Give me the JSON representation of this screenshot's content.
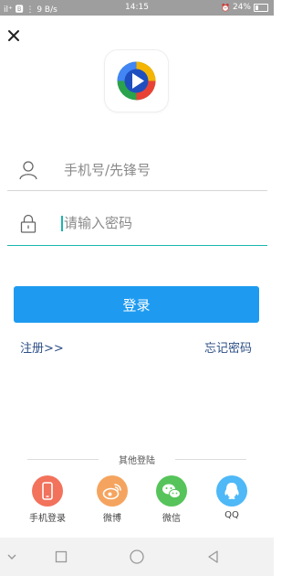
{
  "status_bar": {
    "left": "il⁺ 🅱 ⋮ 9 B/s",
    "time": "14:15",
    "battery": "24%"
  },
  "form": {
    "phone_placeholder": "手机号/先锋号",
    "password_placeholder": "请输入密码",
    "login_label": "登录",
    "register_label": "注册>>",
    "forgot_label": "忘记密码"
  },
  "other_login": {
    "title": "其他登陆",
    "options": [
      {
        "label": "手机登录",
        "color": "#f2725c",
        "icon": "phone-icon"
      },
      {
        "label": "微博",
        "color": "#f5a45f",
        "icon": "weibo-icon"
      },
      {
        "label": "微信",
        "color": "#56c45a",
        "icon": "wechat-icon"
      },
      {
        "label": "QQ",
        "color": "#4fb8f7",
        "icon": "qq-icon"
      }
    ]
  },
  "colors": {
    "accent": "#1e9bf1",
    "focus_line": "#18b6b0",
    "link": "#2d4f86"
  }
}
